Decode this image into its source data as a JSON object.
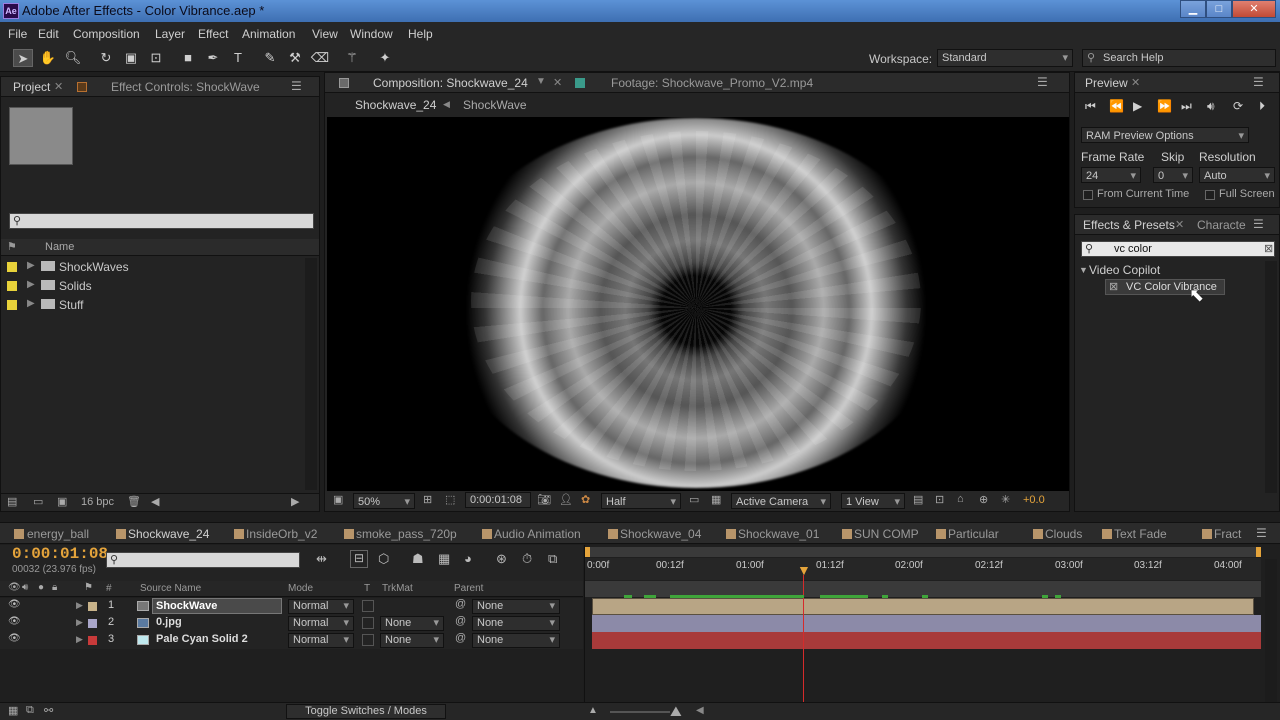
{
  "titlebar": {
    "app_icon": "Ae",
    "title": "Adobe After Effects - Color Vibrance.aep *",
    "min": "▁",
    "max": "□",
    "close": "✕"
  },
  "menu": [
    "File",
    "Edit",
    "Composition",
    "Layer",
    "Effect",
    "Animation",
    "View",
    "Window",
    "Help"
  ],
  "toolbar": {
    "workspace_label": "Workspace:",
    "workspace_value": "Standard",
    "search_placeholder": "Search Help"
  },
  "project": {
    "tab_project": "Project",
    "tab_effect_controls": "Effect Controls: ShockWave",
    "col_name": "Name",
    "items": [
      {
        "name": "ShockWaves",
        "color": "#e8d23a"
      },
      {
        "name": "Solids",
        "color": "#e8d23a"
      },
      {
        "name": "Stuff",
        "color": "#e8d23a"
      }
    ],
    "bpc": "16 bpc"
  },
  "comp": {
    "tab_comp": "Composition: Shockwave_24",
    "tab_footage": "Footage: Shockwave_Promo_V2.mp4",
    "breadcrumb_1": "Shockwave_24",
    "breadcrumb_2": "ShockWave",
    "zoom": "50%",
    "timecode": "0:00:01:08",
    "resolution": "Half",
    "camera": "Active Camera",
    "view": "1 View",
    "exposure": "+0.0"
  },
  "preview": {
    "tab": "Preview",
    "ram_options": "RAM Preview Options",
    "frame_rate_label": "Frame Rate",
    "skip_label": "Skip",
    "resolution_label": "Resolution",
    "frame_rate": "24",
    "skip": "0",
    "resolution": "Auto",
    "from_current": "From Current Time",
    "full_screen": "Full Screen"
  },
  "effects": {
    "tab": "Effects & Presets",
    "tab2": "Characte",
    "search_value": "vc color",
    "category": "Video Copilot",
    "item": "VC Color Vibrance"
  },
  "timeline": {
    "tabs": [
      "energy_ball",
      "Shockwave_24",
      "InsideOrb_v2",
      "smoke_pass_720p",
      "Audio Animation",
      "Shockwave_04",
      "Shockwave_01",
      "SUN COMP",
      "Particular",
      "Clouds",
      "Text Fade",
      "Fract"
    ],
    "tab_colors": [
      "#b8956a",
      "#b8956a",
      "#b8956a",
      "#b8956a",
      "#b8956a",
      "#b8956a",
      "#b8956a",
      "#b8956a",
      "#b8956a",
      "#b8956a",
      "#b8956a",
      "#b8956a"
    ],
    "timecode": "0:00:01:08",
    "frames": "00032 (23.976 fps)",
    "col_hash": "#",
    "col_source": "Source Name",
    "col_mode": "Mode",
    "col_t": "T",
    "col_trkmat": "TrkMat",
    "col_parent": "Parent",
    "layers": [
      {
        "num": "1",
        "name": "ShockWave",
        "mode": "Normal",
        "trkmat": "",
        "parent": "None",
        "color": "#c8b38a"
      },
      {
        "num": "2",
        "name": "0.jpg",
        "mode": "Normal",
        "trkmat": "None",
        "parent": "None",
        "color": "#a9a6c9"
      },
      {
        "num": "3",
        "name": "Pale Cyan Solid 2",
        "mode": "Normal",
        "trkmat": "None",
        "parent": "None",
        "color": "#c83a3a"
      }
    ],
    "ruler": [
      "0:00f",
      "00:12f",
      "01:00f",
      "01:12f",
      "02:00f",
      "02:12f",
      "03:00f",
      "03:12f",
      "04:00f"
    ],
    "toggle": "Toggle Switches / Modes"
  }
}
